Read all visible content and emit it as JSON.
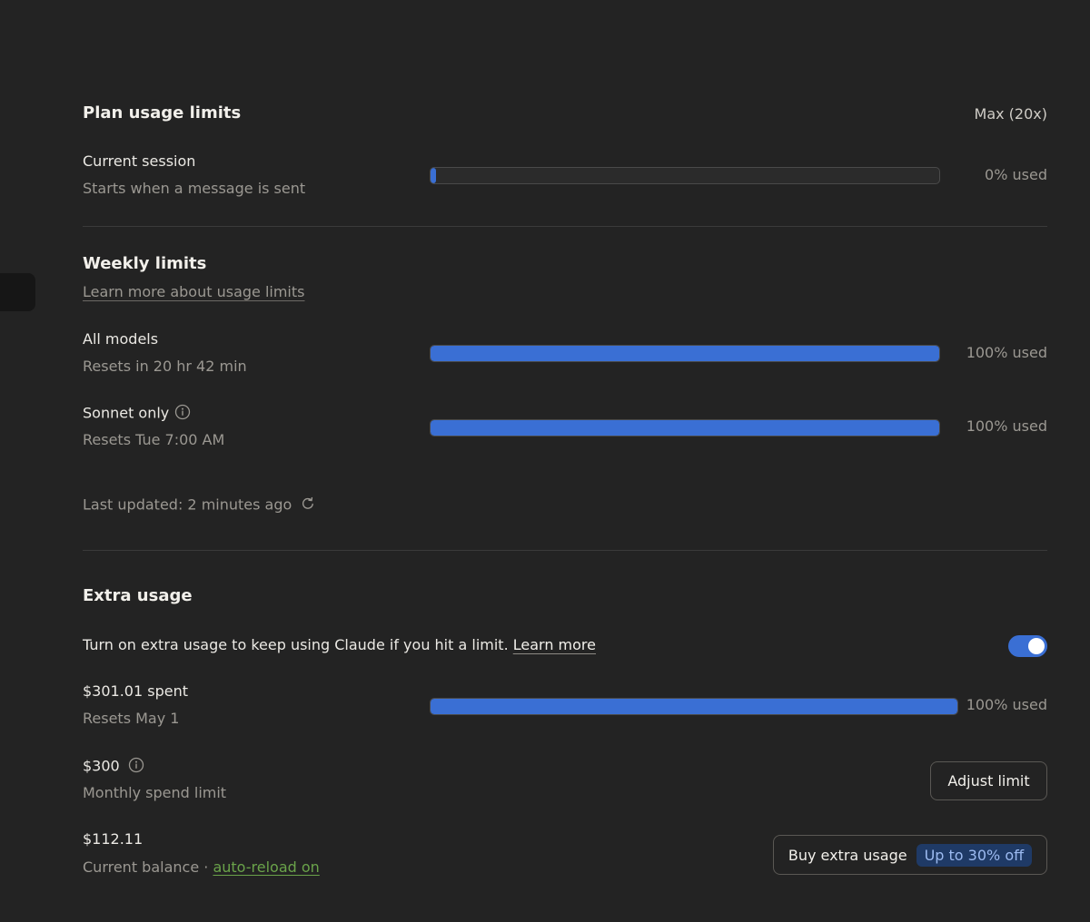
{
  "plan": {
    "title": "Plan usage limits",
    "tier": "Max (20x)",
    "session": {
      "label": "Current session",
      "sub": "Starts when a message is sent",
      "used_pct": 1,
      "used_label": "0% used"
    }
  },
  "weekly": {
    "title": "Weekly limits",
    "learn_link": "Learn more about usage limits",
    "all_models": {
      "label": "All models",
      "sub": "Resets in 20 hr 42 min",
      "used_pct": 100,
      "used_label": "100% used"
    },
    "sonnet": {
      "label": "Sonnet only",
      "sub": "Resets Tue 7:00 AM",
      "used_pct": 100,
      "used_label": "100% used"
    },
    "last_updated": "Last updated: 2 minutes ago"
  },
  "extra": {
    "title": "Extra usage",
    "description": "Turn on extra usage to keep using Claude if you hit a limit.",
    "learn_more": "Learn more",
    "toggle_on": true,
    "spent": {
      "label": "$301.01 spent",
      "sub": "Resets May 1",
      "used_pct": 100,
      "used_label": "100% used"
    },
    "limit": {
      "amount": "$300",
      "sub": "Monthly spend limit",
      "button": "Adjust limit"
    },
    "balance": {
      "amount": "$112.11",
      "sub": "Current balance",
      "separator": "·",
      "auto_reload": "auto-reload on",
      "button": "Buy extra usage",
      "badge": "Up to 30% off"
    }
  },
  "colors": {
    "background": "#232323",
    "accent": "#3a6fd4",
    "link_green": "#6aa34a"
  }
}
